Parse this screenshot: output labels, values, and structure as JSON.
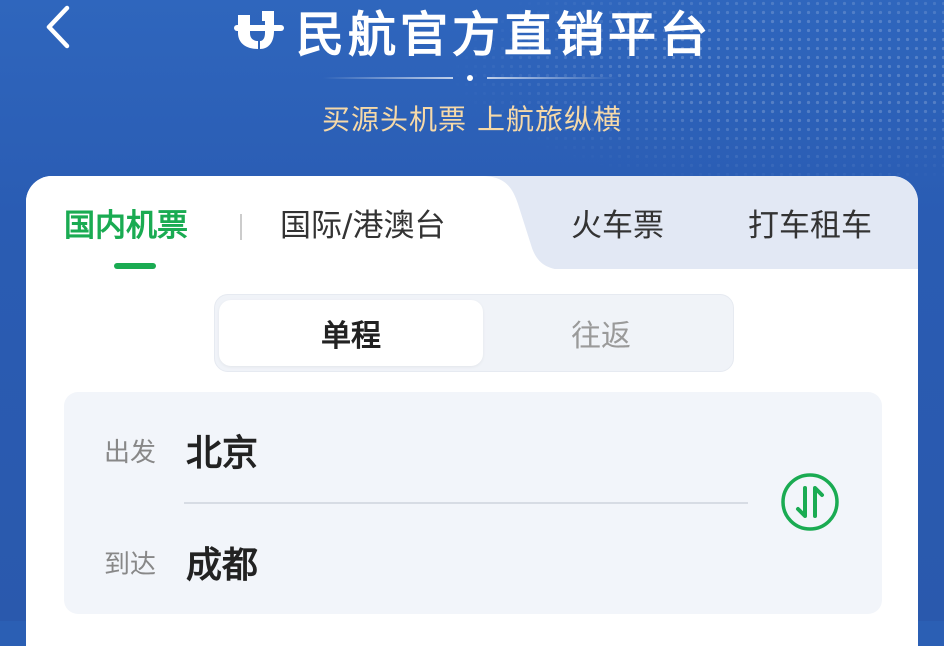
{
  "header": {
    "title": "民航官方直销平台",
    "slogan": "买源头机票 上航旅纵横"
  },
  "tabs": [
    {
      "label": "国内机票",
      "active": true
    },
    {
      "label": "国际/港澳台",
      "active": false
    },
    {
      "label": "火车票",
      "active": false
    },
    {
      "label": "打车租车",
      "active": false
    }
  ],
  "trip_type": {
    "options": [
      "单程",
      "往返"
    ],
    "selected": "单程"
  },
  "route": {
    "departure_label": "出发",
    "departure_city": "北京",
    "arrival_label": "到达",
    "arrival_city": "成都"
  },
  "colors": {
    "brand_blue": "#2b5fb4",
    "accent_green": "#1aab52",
    "slogan_gold": "#f6d9a8"
  },
  "icons": {
    "back": "back-chevron-icon",
    "logo": "airline-logo-icon",
    "swap": "swap-cities-icon"
  }
}
